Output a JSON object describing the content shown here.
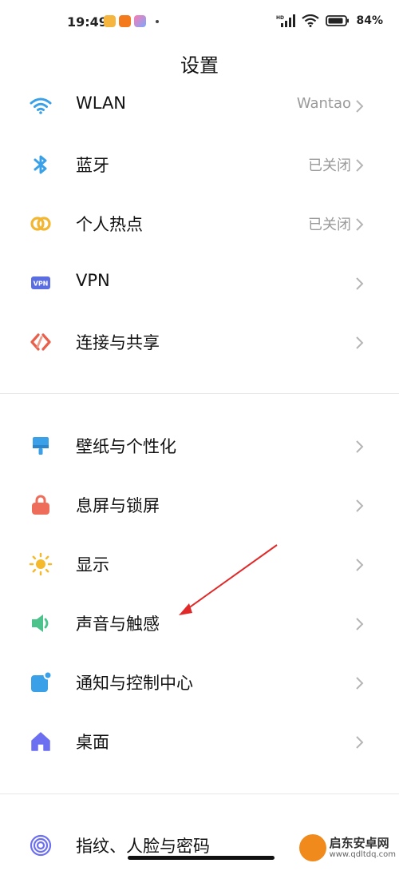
{
  "status_bar": {
    "time": "19:49",
    "battery": "84%"
  },
  "header": {
    "title": "设置"
  },
  "section1": [
    {
      "label": "WLAN",
      "value": "Wantao",
      "icon": "wifi-icon"
    },
    {
      "label": "蓝牙",
      "value": "已关闭",
      "icon": "bluetooth-icon"
    },
    {
      "label": "个人热点",
      "value": "已关闭",
      "icon": "hotspot-icon"
    },
    {
      "label": "VPN",
      "value": "",
      "icon": "vpn-icon"
    },
    {
      "label": "连接与共享",
      "value": "",
      "icon": "connect-share-icon"
    }
  ],
  "section2": [
    {
      "label": "壁纸与个性化",
      "icon": "wallpaper-icon"
    },
    {
      "label": "息屏与锁屏",
      "icon": "lock-icon"
    },
    {
      "label": "显示",
      "icon": "brightness-icon"
    },
    {
      "label": "声音与触感",
      "icon": "sound-icon"
    },
    {
      "label": "通知与控制中心",
      "icon": "notification-icon"
    },
    {
      "label": "桌面",
      "icon": "home-icon"
    }
  ],
  "section3": [
    {
      "label": "指纹、人脸与密码",
      "icon": "fingerprint-icon"
    }
  ],
  "watermark": {
    "name": "启东安卓网",
    "url": "www.qdltdq.com"
  },
  "colors": {
    "wifi": "#3aa0e8",
    "bluetooth": "#3aa0e8",
    "hotspot": "#f2b632",
    "vpn": "#5b6ee1",
    "connect": "#e8604c",
    "wallpaper": "#3aa0e8",
    "lock": "#ee6c5a",
    "display": "#f5b92c",
    "sound": "#4cc38a",
    "notification": "#3aa0e8",
    "home": "#6b6ff0",
    "fingerprint": "#6b6ff0",
    "arrow": "#e02a2a"
  }
}
